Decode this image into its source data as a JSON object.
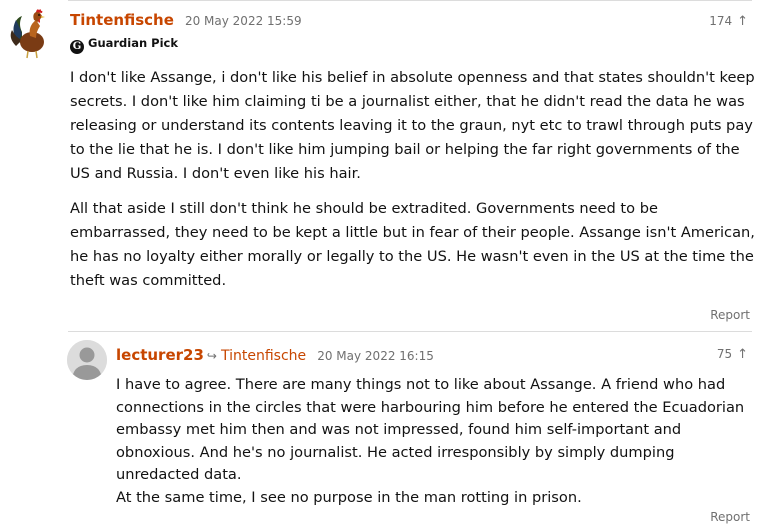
{
  "comment1": {
    "author": "Tintenfische",
    "timestamp": "20 May 2022 15:59",
    "votes": "174",
    "badge": "Guardian Pick",
    "paragraphs": [
      "I don't like Assange, i don't like his belief in absolute openness and that states shouldn't keep secrets. I don't like him claiming ti be a journalist either, that he didn't read the data he was releasing or understand its contents leaving it to the graun, nyt etc to trawl through puts pay to the lie that he is. I don't like him jumping bail or helping the far right governments of the US and Russia. I don't even like his hair.",
      "All that aside I still don't think he should be extradited. Governments need to be embarrassed, they need to be kept a little but in fear of their people. Assange isn't American, he has no loyalty either morally or legally to the US. He wasn't even in the US at the time the theft was committed."
    ],
    "report": "Report"
  },
  "comment2": {
    "author": "lecturer23",
    "reply_to": "Tintenfische",
    "timestamp": "20 May 2022 16:15",
    "votes": "75",
    "paragraphs": [
      "I have to agree. There are many things not to like about Assange. A friend who had connections in the circles that were harbouring him before he entered the Ecuadorian embassy met him then and was not impressed, found him self-important and obnoxious. And he's no journalist. He acted irresponsibly by simply dumping unredacted data.",
      "At the same time, I see no purpose in the man rotting in prison."
    ],
    "report": "Report"
  },
  "icons": {
    "upvote": "arrow-up-icon",
    "reply": "reply-arrow-icon",
    "badge": "guardian-logo-icon",
    "avatar1": "rooster-avatar",
    "avatar2": "default-user-avatar"
  },
  "colors": {
    "author": "#c74600",
    "meta": "#707070",
    "text": "#121212",
    "divider": "#dcdcdc"
  }
}
